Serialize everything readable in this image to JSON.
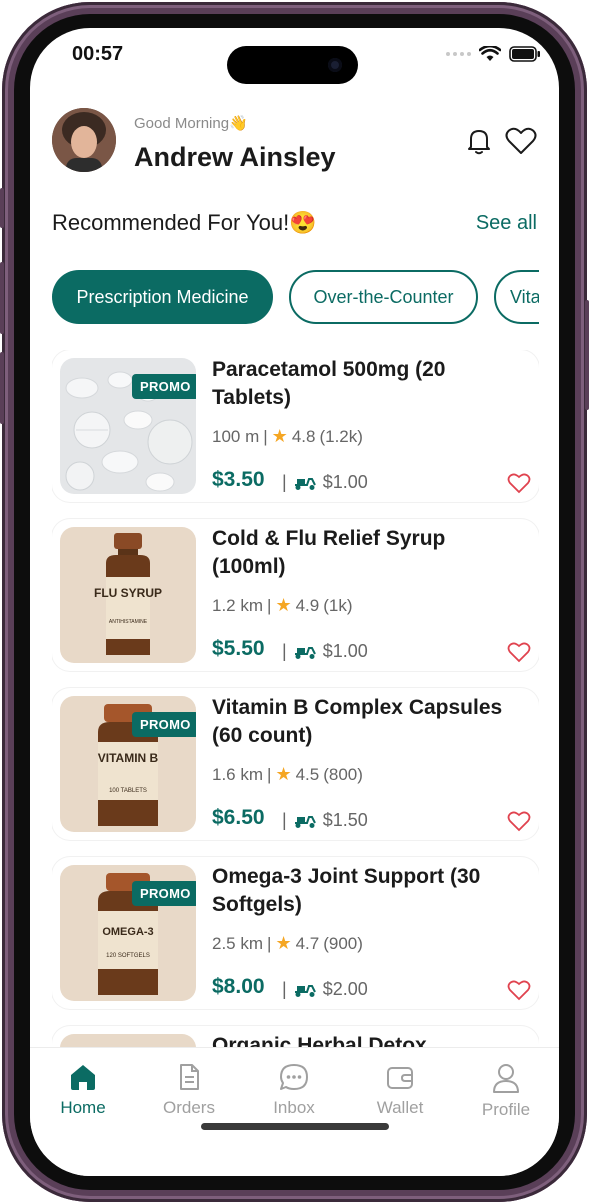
{
  "status_bar": {
    "time": "00:57"
  },
  "header": {
    "greeting": "Good Morning👋",
    "user_name": "Andrew Ainsley"
  },
  "section": {
    "title": "Recommended For You!😍",
    "see_all": "See all"
  },
  "chips": [
    {
      "label": "Prescription Medicine",
      "active": true
    },
    {
      "label": "Over-the-Counter",
      "active": false
    },
    {
      "label": "Vitamins",
      "active": false
    }
  ],
  "products": [
    {
      "name": "Paracetamol 500mg (20 Tablets)",
      "distance": "100 m",
      "rating": "4.8",
      "reviews": "(1.2k)",
      "price": "$3.50",
      "delivery": "$1.00",
      "promo": "PROMO"
    },
    {
      "name": "Cold & Flu Relief Syrup (100ml)",
      "distance": "1.2 km",
      "rating": "4.9",
      "reviews": "(1k)",
      "price": "$5.50",
      "delivery": "$1.00",
      "promo": "",
      "bottle_label": "FLU SYRUP",
      "bottle_sub": "ANTIHISTAMINE"
    },
    {
      "name": "Vitamin B Complex Capsules (60 count)",
      "distance": "1.6 km",
      "rating": "4.5",
      "reviews": "(800)",
      "price": "$6.50",
      "delivery": "$1.50",
      "promo": "PROMO",
      "bottle_label": "VITAMIN B",
      "bottle_sub": "100 TABLETS"
    },
    {
      "name": "Omega-3 Joint Support (30 Softgels)",
      "distance": "2.5 km",
      "rating": "4.7",
      "reviews": "(900)",
      "price": "$8.00",
      "delivery": "$2.00",
      "promo": "PROMO",
      "bottle_label": "OMEGA-3",
      "bottle_sub": "120 SOFTGELS"
    },
    {
      "name": "Organic Herbal Detox"
    }
  ],
  "nav": {
    "items": [
      {
        "label": "Home",
        "icon": "home-icon",
        "active": true
      },
      {
        "label": "Orders",
        "icon": "orders-icon"
      },
      {
        "label": "Inbox",
        "icon": "inbox-icon"
      },
      {
        "label": "Wallet",
        "icon": "wallet-icon"
      },
      {
        "label": "Profile",
        "icon": "profile-icon"
      }
    ]
  },
  "colors": {
    "primary": "#0b6b63",
    "star": "#f5a623",
    "favorite": "#e0434f"
  }
}
